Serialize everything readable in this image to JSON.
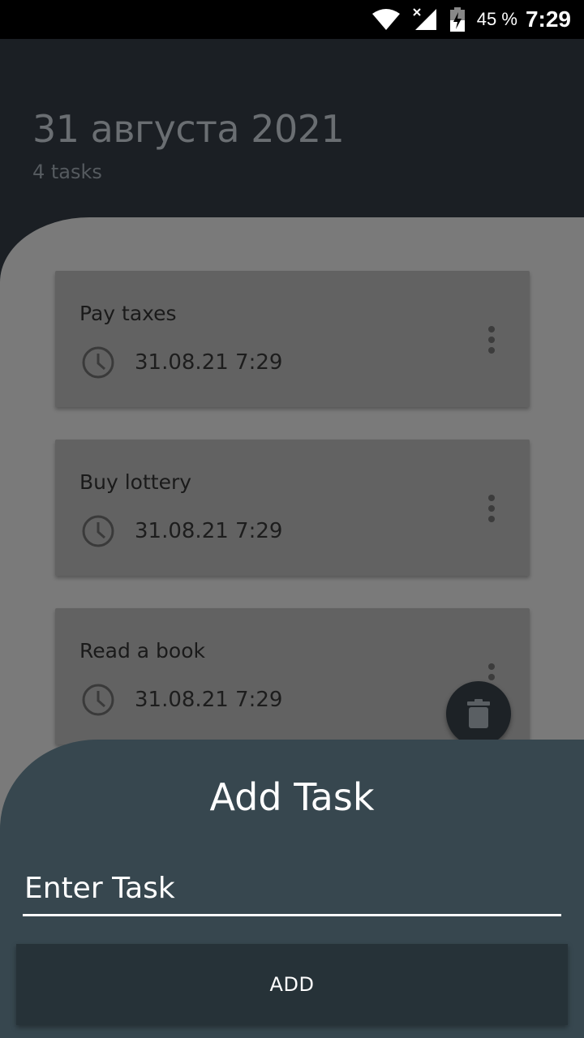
{
  "status_bar": {
    "battery_percent": "45 %",
    "time": "7:29",
    "icons": [
      "wifi-icon",
      "signal-icon",
      "battery-icon"
    ]
  },
  "header": {
    "date": "31 августа 2021",
    "tasks_count": "4 tasks"
  },
  "tasks": [
    {
      "title": "Pay taxes",
      "time": "31.08.21 7:29"
    },
    {
      "title": "Buy lottery",
      "time": "31.08.21 7:29"
    },
    {
      "title": "Read a book",
      "time": "31.08.21 7:29"
    }
  ],
  "fab": {
    "icon": "trash-icon"
  },
  "sheet": {
    "title": "Add Task",
    "input_placeholder": "Enter Task",
    "input_value": "",
    "add_label": "ADD"
  },
  "colors": {
    "sheet_bg": "#37474f",
    "button_bg": "#263238",
    "header_bg": "#1b1f24"
  }
}
